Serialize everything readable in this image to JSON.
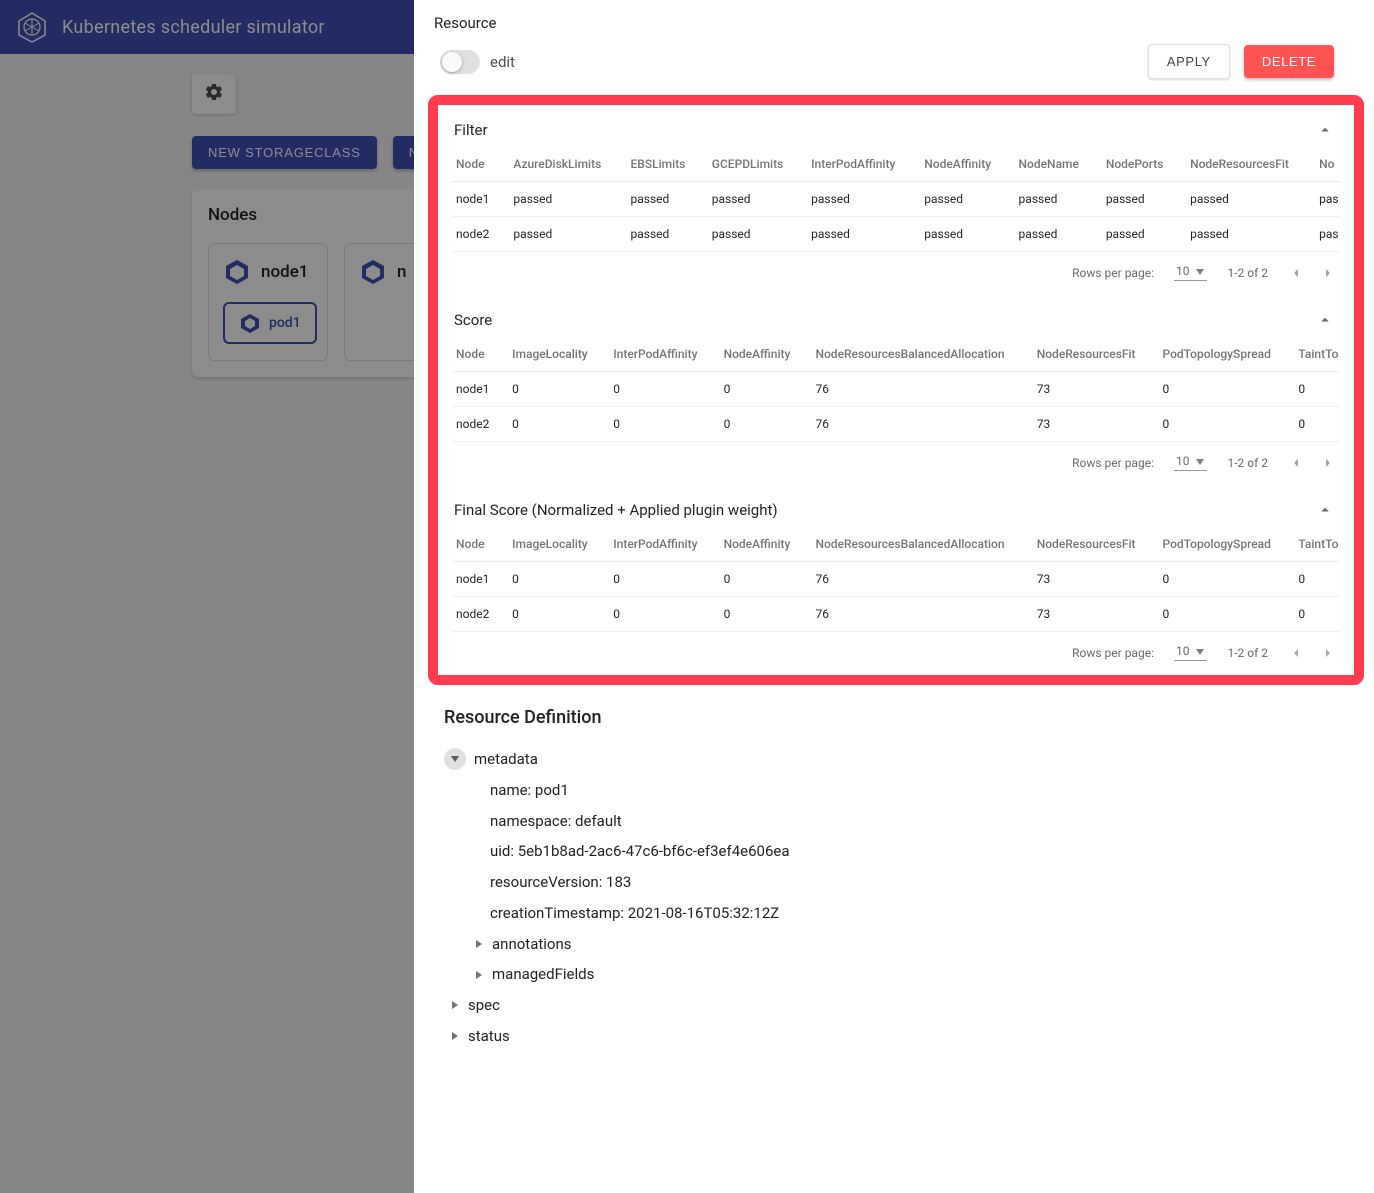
{
  "appbar": {
    "title": "Kubernetes scheduler simulator"
  },
  "bg": {
    "btn_storageclass": "NEW STORAGECLASS",
    "btn_next": "NE",
    "nodes_title": "Nodes",
    "nodes": [
      {
        "name": "node1",
        "pod": "pod1"
      },
      {
        "name": "n"
      }
    ]
  },
  "panel": {
    "resource_title": "Resource",
    "edit_label": "edit",
    "apply": "APPLY",
    "delete": "DELETE",
    "sections": {
      "filter": {
        "title": "Filter",
        "headers": [
          "Node",
          "AzureDiskLimits",
          "EBSLimits",
          "GCEPDLimits",
          "InterPodAffinity",
          "NodeAffinity",
          "NodeName",
          "NodePorts",
          "NodeResourcesFit",
          "No"
        ],
        "rows": [
          [
            "node1",
            "passed",
            "passed",
            "passed",
            "passed",
            "passed",
            "passed",
            "passed",
            "passed",
            "pas"
          ],
          [
            "node2",
            "passed",
            "passed",
            "passed",
            "passed",
            "passed",
            "passed",
            "passed",
            "passed",
            "pas"
          ]
        ],
        "footer": {
          "rpp_label": "Rows per page:",
          "rpp": "10",
          "range": "1-2 of 2"
        }
      },
      "score": {
        "title": "Score",
        "headers": [
          "Node",
          "ImageLocality",
          "InterPodAffinity",
          "NodeAffinity",
          "NodeResourcesBalancedAllocation",
          "NodeResourcesFit",
          "PodTopologySpread",
          "TaintTo"
        ],
        "rows": [
          [
            "node1",
            "0",
            "0",
            "0",
            "76",
            "73",
            "0",
            "0"
          ],
          [
            "node2",
            "0",
            "0",
            "0",
            "76",
            "73",
            "0",
            "0"
          ]
        ],
        "footer": {
          "rpp_label": "Rows per page:",
          "rpp": "10",
          "range": "1-2 of 2"
        }
      },
      "final": {
        "title": "Final Score (Normalized + Applied plugin weight)",
        "headers": [
          "Node",
          "ImageLocality",
          "InterPodAffinity",
          "NodeAffinity",
          "NodeResourcesBalancedAllocation",
          "NodeResourcesFit",
          "PodTopologySpread",
          "TaintTo"
        ],
        "rows": [
          [
            "node1",
            "0",
            "0",
            "0",
            "76",
            "73",
            "0",
            "0"
          ],
          [
            "node2",
            "0",
            "0",
            "0",
            "76",
            "73",
            "0",
            "0"
          ]
        ],
        "footer": {
          "rpp_label": "Rows per page:",
          "rpp": "10",
          "range": "1-2 of 2"
        }
      }
    },
    "resdef": {
      "title": "Resource Definition",
      "metadata_label": "metadata",
      "metadata_fields": [
        "name: pod1",
        "namespace: default",
        "uid: 5eb1b8ad-2ac6-47c6-bf6c-ef3ef4e606ea",
        "resourceVersion: 183",
        "creationTimestamp: 2021-08-16T05:32:12Z"
      ],
      "metadata_children": [
        "annotations",
        "managedFields"
      ],
      "top_collapsed": [
        "spec",
        "status"
      ]
    }
  }
}
